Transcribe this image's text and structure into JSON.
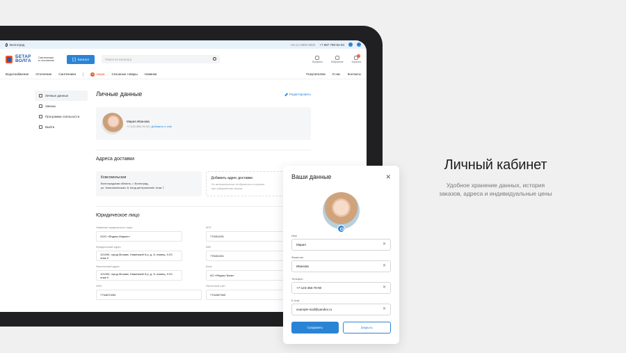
{
  "topbar": {
    "city": "Волгоград",
    "phone_label": "тел.по 8800 9000",
    "phone": "+7 987 790-92-94"
  },
  "header": {
    "logo_top": "БЕТАР",
    "logo_bottom": "ВОЛГА",
    "logo_sub_1": "Сантехника",
    "logo_sub_2": "и отопление",
    "catalog_label": "Каталог",
    "search_placeholder": "Поиск по каталогу",
    "icons": [
      {
        "label": "Профиль",
        "icon": "user-icon"
      },
      {
        "label": "Избранное",
        "icon": "heart-icon"
      },
      {
        "label": "Корзина",
        "icon": "cart-icon",
        "badge": "2"
      }
    ]
  },
  "nav": {
    "items": [
      "Водоснабжение",
      "Отопление",
      "Сантехника"
    ],
    "promo": "Акции",
    "promo_icon": "%",
    "items2": [
      "Сезонные товары",
      "Новинки"
    ],
    "right": [
      "Покупателям",
      "О нас",
      "Контакты"
    ]
  },
  "sidebar": {
    "items": [
      {
        "label": "Личные данные",
        "icon": "user-icon",
        "active": true
      },
      {
        "label": "Заказы",
        "icon": "box-icon",
        "active": false
      },
      {
        "label": "Программа лояльности",
        "icon": "card-icon",
        "active": false
      },
      {
        "label": "Выйти",
        "icon": "logout-icon",
        "active": false
      }
    ]
  },
  "main": {
    "title": "Личные данные",
    "edit_label": "Редактировать",
    "profile": {
      "name": "Мария Иванова",
      "phone": "+7-123-456-78-90",
      "divider": "|",
      "add_email": "Добавить e-mail"
    },
    "delivery_title": "Адреса доставки",
    "address": {
      "title": "Комсомольская",
      "line1": "Волгоградская область, г. Волгоград,",
      "line2": "ул. Комсомольская, 6, вход центральный, этаж 7"
    },
    "add_address": {
      "title": "Добавить адрес доставки",
      "line1": "Он автоматически отобразится в корзине",
      "line2": "при оформлении заказа"
    },
    "legal_title": "Юридическое лицо",
    "legal_fields": [
      {
        "label": "Название юридического лица",
        "value": "ООО «Яндекс.Маркет»",
        "short": true
      },
      {
        "label": "КПП",
        "value": "770401001",
        "short": false
      },
      {
        "label": "Юридический адрес",
        "value": "121099, город Москва, Новинский б-р, д. 8, помещ. 9.03 этаж 9",
        "short": true
      },
      {
        "label": "БИК",
        "value": "775401001",
        "short": false
      },
      {
        "label": "Фактический адрес",
        "value": "121099, город Москва, Новинский б-р, д. 8, помещ. 9.03 этаж 9",
        "short": true
      },
      {
        "label": "Банк",
        "value": "АО «Яндекс Банк»",
        "short": false
      },
      {
        "label": "ИНН",
        "value": "7734670263",
        "short": false
      },
      {
        "label": "Расчётный счёт",
        "value": "7704357909",
        "short": false
      }
    ]
  },
  "hero": {
    "title": "Личный кабинет",
    "subtitle_1": "Удобное хранение данных, история",
    "subtitle_2": "заказов, адреса и индивидуальные цены"
  },
  "modal": {
    "title": "Ваши данные",
    "close": "✕",
    "fields": [
      {
        "label": "Имя",
        "value": "Мария"
      },
      {
        "label": "Фамилия",
        "value": "Иванова"
      },
      {
        "label": "Телефон",
        "value": "+7-123-456-78-90"
      },
      {
        "label": "E-mail",
        "value": "example-mail@yandex.ru"
      }
    ],
    "clear_icon": "✕",
    "save_label": "Сохранить",
    "close_label": "Закрыть"
  }
}
